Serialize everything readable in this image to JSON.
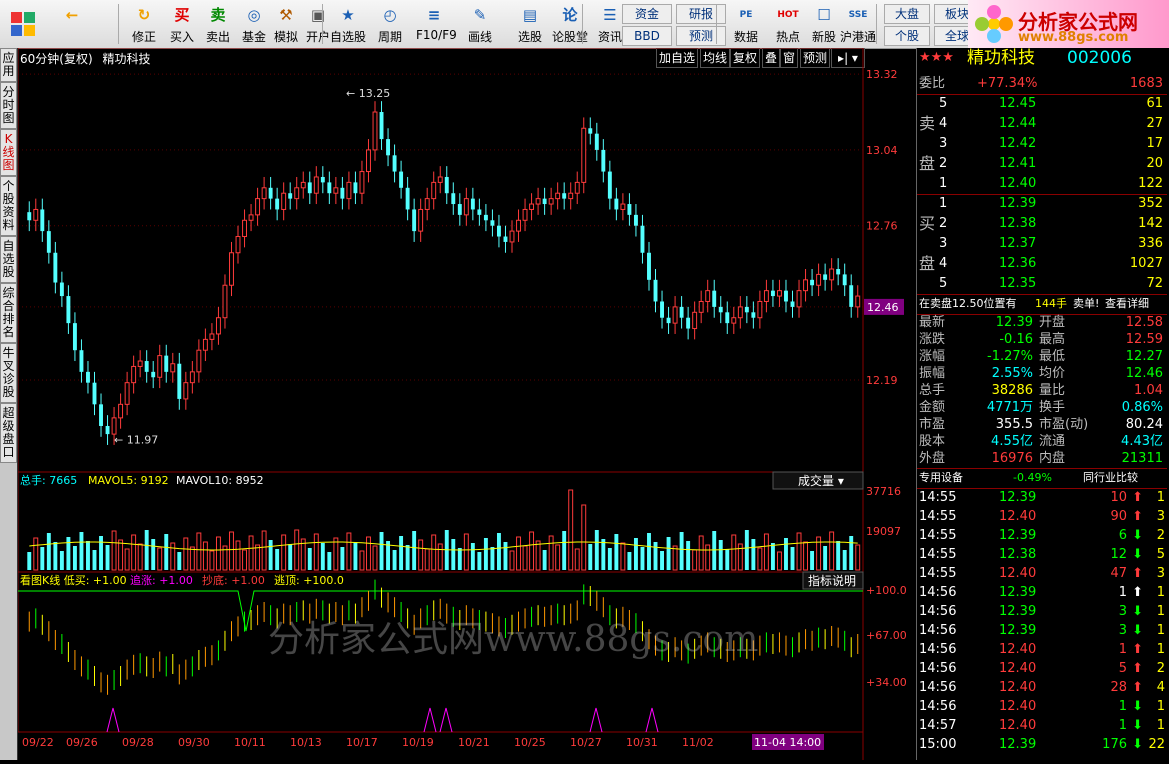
{
  "toolbar": {
    "buttons": [
      {
        "name": "back-button",
        "label": "",
        "icon": "←",
        "color": "#f0a000"
      },
      {
        "name": "refresh-button",
        "label": "修正",
        "icon": "↻",
        "color": "#f0a000"
      },
      {
        "name": "buy-button",
        "label": "买入",
        "icon": "买",
        "color": "#e00000"
      },
      {
        "name": "sell-button",
        "label": "卖出",
        "icon": "卖",
        "color": "#008800"
      },
      {
        "name": "fund-button",
        "label": "基金",
        "icon": "◎",
        "color": "#1a5fb4"
      },
      {
        "name": "simulate-button",
        "label": "模拟",
        "icon": "⚒",
        "color": "#b05a00"
      },
      {
        "name": "open-account-button",
        "label": "开户",
        "icon": "▣",
        "color": "#555"
      },
      {
        "name": "self-select-button",
        "label": "自选股",
        "icon": "★",
        "color": "#1a5fb4"
      },
      {
        "name": "period-button",
        "label": "周期",
        "icon": "◴",
        "color": "#1a5fb4"
      },
      {
        "name": "f10-button",
        "label": "F10/F9",
        "icon": "≡",
        "color": "#1a5fb4"
      },
      {
        "name": "draw-line-button",
        "label": "画线",
        "icon": "✎",
        "color": "#1a5fb4"
      },
      {
        "name": "stock-select-button",
        "label": "选股",
        "icon": "▤",
        "color": "#1a5fb4"
      },
      {
        "name": "forum-button",
        "label": "论股堂",
        "icon": "论",
        "color": "#1a5fb4"
      },
      {
        "name": "info-button",
        "label": "资讯",
        "icon": "☰",
        "color": "#1a5fb4"
      },
      {
        "name": "data-button",
        "label": "数据",
        "icon": "PE",
        "color": "#1a5fb4"
      },
      {
        "name": "hot-button",
        "label": "热点",
        "icon": "HOT",
        "color": "#e00000"
      },
      {
        "name": "new-stock-button",
        "label": "新股",
        "icon": "☐",
        "color": "#1a5fb4"
      },
      {
        "name": "hk-connect-button",
        "label": "沪港通",
        "icon": "SSE",
        "color": "#1a5fb4"
      }
    ],
    "pairs": [
      {
        "top": "资金",
        "bottom": "BBD"
      },
      {
        "top": "研报",
        "bottom": "预测"
      },
      {
        "top": "大盘",
        "bottom": "个股"
      },
      {
        "top": "板块",
        "bottom": "全球"
      }
    ],
    "logo_title": "分析家公式网",
    "logo_url": "www.88gs.com"
  },
  "side_tabs": [
    "应用",
    "分时图",
    "K线图",
    "个股资料",
    "自选股",
    "综合排名",
    "牛叉诊股",
    "超级盘口"
  ],
  "chart_header": {
    "period": "60分钟(复权)",
    "stock_name": "精功科技",
    "tabs": [
      "加自选",
      "均线",
      "复权",
      "叠",
      "窗",
      "预测"
    ]
  },
  "chart_data": [
    {
      "type": "candlestick",
      "title": "60分钟(复权)",
      "series_name": "精功科技",
      "y_ticks": [
        13.32,
        13.04,
        12.76,
        12.46,
        12.19
      ],
      "current_price_label": "12.46",
      "annotations": [
        {
          "text": "13.25",
          "value": 13.25
        },
        {
          "text": "11.97",
          "value": 11.97
        }
      ],
      "x_labels": [
        "09/22",
        "09/26",
        "09/28",
        "09/30",
        "10/11",
        "10/13",
        "10/17",
        "10/19",
        "10/21",
        "10/25",
        "10/27",
        "10/31",
        "11/02",
        "11-04 14:00"
      ],
      "ylim": [
        11.85,
        13.35
      ],
      "candles_close": [
        12.78,
        12.82,
        12.74,
        12.66,
        12.55,
        12.5,
        12.4,
        12.3,
        12.22,
        12.18,
        12.1,
        12.02,
        11.99,
        12.05,
        12.1,
        12.18,
        12.24,
        12.26,
        12.22,
        12.2,
        12.28,
        12.22,
        12.25,
        12.12,
        12.18,
        12.22,
        12.3,
        12.34,
        12.36,
        12.42,
        12.54,
        12.66,
        12.72,
        12.78,
        12.8,
        12.86,
        12.9,
        12.86,
        12.82,
        12.88,
        12.86,
        12.9,
        12.92,
        12.88,
        12.94,
        12.92,
        12.88,
        12.9,
        12.86,
        12.92,
        12.88,
        12.96,
        13.04,
        13.18,
        13.08,
        13.02,
        12.96,
        12.9,
        12.82,
        12.74,
        12.82,
        12.86,
        12.92,
        12.94,
        12.88,
        12.84,
        12.8,
        12.86,
        12.82,
        12.8,
        12.78,
        12.76,
        12.72,
        12.7,
        12.74,
        12.78,
        12.82,
        12.84,
        12.86,
        12.84,
        12.86,
        12.88,
        12.86,
        12.88,
        12.92,
        13.12,
        13.1,
        13.04,
        12.96,
        12.86,
        12.82,
        12.84,
        12.8,
        12.76,
        12.66,
        12.56,
        12.48,
        12.42,
        12.4,
        12.46,
        12.42,
        12.38,
        12.44,
        12.48,
        12.52,
        12.46,
        12.44,
        12.4,
        12.42,
        12.46,
        12.44,
        12.42,
        12.48,
        12.52,
        12.5,
        12.52,
        12.48,
        12.46,
        12.52,
        12.56,
        12.54,
        12.58,
        12.56,
        12.6,
        12.58,
        12.54,
        12.46,
        12.5
      ],
      "volume": {
        "label": "总手",
        "value": "7665",
        "mavol5": "9192",
        "mavol10": "8952",
        "indicator": "成交量",
        "y_ticks": [
          "37716",
          "19097"
        ]
      },
      "indicator": {
        "name": "看图K线",
        "low_buy": "+1.00",
        "chase": "+1.00",
        "bottom_fish": "+1.00",
        "escape_top": "+100.0",
        "button": "指标说明",
        "y_ticks": [
          "+100.0",
          "+67.00",
          "+34.00"
        ]
      }
    }
  ],
  "quote": {
    "stars": "★★★",
    "name": "精功科技",
    "code": "002006",
    "weibi_label": "委比",
    "weibi_value": "+77.34%",
    "weibi_diff": "1683",
    "sell_label": [
      "卖",
      "盘"
    ],
    "buy_label": [
      "买",
      "盘"
    ],
    "asks": [
      {
        "level": "5",
        "price": "12.45",
        "vol": "61"
      },
      {
        "level": "4",
        "price": "12.44",
        "vol": "27"
      },
      {
        "level": "3",
        "price": "12.42",
        "vol": "17"
      },
      {
        "level": "2",
        "price": "12.41",
        "vol": "20"
      },
      {
        "level": "1",
        "price": "12.40",
        "vol": "122"
      }
    ],
    "bids": [
      {
        "level": "1",
        "price": "12.39",
        "vol": "352"
      },
      {
        "level": "2",
        "price": "12.38",
        "vol": "142"
      },
      {
        "level": "3",
        "price": "12.37",
        "vol": "336"
      },
      {
        "level": "4",
        "price": "12.36",
        "vol": "1027"
      },
      {
        "level": "5",
        "price": "12.35",
        "vol": "72"
      }
    ],
    "notice": {
      "a": "在卖盘12.50位置有",
      "b": "144手",
      "c": "卖单!",
      "d": "查看详细"
    },
    "stats": [
      {
        "l1": "最新",
        "v1": "12.39",
        "c1": "g",
        "l2": "开盘",
        "v2": "12.58",
        "c2": "r"
      },
      {
        "l1": "涨跌",
        "v1": "-0.16",
        "c1": "g",
        "l2": "最高",
        "v2": "12.59",
        "c2": "r"
      },
      {
        "l1": "涨幅",
        "v1": "-1.27%",
        "c1": "g",
        "l2": "最低",
        "v2": "12.27",
        "c2": "g"
      },
      {
        "l1": "振幅",
        "v1": "2.55%",
        "c1": "c",
        "l2": "均价",
        "v2": "12.46",
        "c2": "g"
      },
      {
        "l1": "总手",
        "v1": "38286",
        "c1": "y",
        "l2": "量比",
        "v2": "1.04",
        "c2": "r"
      },
      {
        "l1": "金额",
        "v1": "4771万",
        "c1": "c",
        "l2": "换手",
        "v2": "0.86%",
        "c2": "c"
      },
      {
        "l1": "市盈",
        "v1": "355.5",
        "c1": "w",
        "l2": "市盈(动)",
        "v2": "80.24",
        "c2": "w"
      },
      {
        "l1": "股本",
        "v1": "4.55亿",
        "c1": "c",
        "l2": "流通",
        "v2": "4.43亿",
        "c2": "c"
      },
      {
        "l1": "外盘",
        "v1": "16976",
        "c1": "r",
        "l2": "内盘",
        "v2": "21311",
        "c2": "g"
      }
    ],
    "tabs": {
      "a": "专用设备",
      "b": "-0.49%",
      "c": "同行业比较"
    },
    "ticks": [
      {
        "time": "14:55",
        "price": "12.39",
        "vol": "10",
        "dir": "up",
        "cnt": "1"
      },
      {
        "time": "14:55",
        "price": "12.40",
        "vol": "90",
        "dir": "up",
        "cnt": "3"
      },
      {
        "time": "14:55",
        "price": "12.39",
        "vol": "6",
        "dir": "down",
        "cnt": "2"
      },
      {
        "time": "14:55",
        "price": "12.38",
        "vol": "12",
        "dir": "down",
        "cnt": "5"
      },
      {
        "time": "14:55",
        "price": "12.40",
        "vol": "47",
        "dir": "up",
        "cnt": "3"
      },
      {
        "time": "14:56",
        "price": "12.39",
        "vol": "1",
        "dir": "white",
        "cnt": "1"
      },
      {
        "time": "14:56",
        "price": "12.39",
        "vol": "3",
        "dir": "down",
        "cnt": "1"
      },
      {
        "time": "14:56",
        "price": "12.39",
        "vol": "3",
        "dir": "down",
        "cnt": "1"
      },
      {
        "time": "14:56",
        "price": "12.40",
        "vol": "1",
        "dir": "up",
        "cnt": "1"
      },
      {
        "time": "14:56",
        "price": "12.40",
        "vol": "5",
        "dir": "up",
        "cnt": "2"
      },
      {
        "time": "14:56",
        "price": "12.40",
        "vol": "28",
        "dir": "up",
        "cnt": "4"
      },
      {
        "time": "14:56",
        "price": "12.40",
        "vol": "1",
        "dir": "down",
        "cnt": "1"
      },
      {
        "time": "14:57",
        "price": "12.40",
        "vol": "1",
        "dir": "down",
        "cnt": "1"
      },
      {
        "time": "15:00",
        "price": "12.39",
        "vol": "176",
        "dir": "down",
        "cnt": "22"
      }
    ]
  },
  "watermark": "分析家公式网www.88gs.com",
  "colors": {
    "up": "#ff3b3b",
    "down": "#54ffff",
    "axis": "#8a0000",
    "text_yellow": "#ffff00"
  }
}
